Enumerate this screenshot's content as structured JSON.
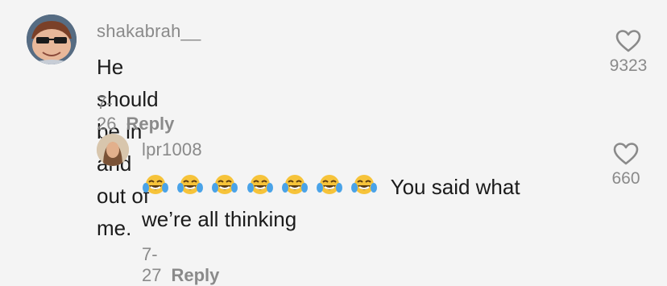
{
  "comments": [
    {
      "username": "shakabrah__",
      "text": "He should be in and out of me.",
      "date": "7-26",
      "reply_label": "Reply",
      "likes": "9323",
      "avatar_icon": "cartoon-face-avatar"
    },
    {
      "username": "lpr1008",
      "text_after_emoji": "You said what",
      "text_line2": "we’re all thinking",
      "emoji_icon": "face-with-tears-of-joy",
      "emoji_count": 7,
      "date": "7-27",
      "reply_label": "Reply",
      "likes": "660",
      "avatar_icon": "profile-photo-avatar"
    }
  ],
  "colors": {
    "background": "#f4f4f4",
    "text": "#1b1b1b",
    "muted": "#8a8a8a",
    "emoji_face": "#f6c33a"
  }
}
